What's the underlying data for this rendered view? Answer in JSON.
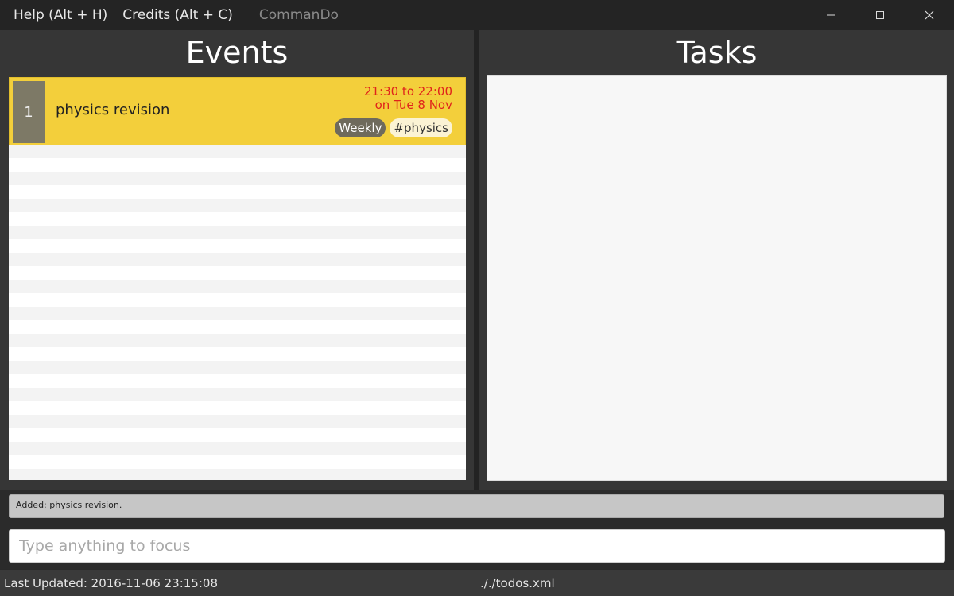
{
  "menu": {
    "help_label": "Help (Alt + H)",
    "credits_label": "Credits (Alt + C)",
    "app_title": "CommanDo"
  },
  "window_controls": {
    "minimize_icon": "minimize-icon",
    "maximize_icon": "maximize-icon",
    "close_icon": "close-icon"
  },
  "events": {
    "title": "Events",
    "items": [
      {
        "index": "1",
        "name": "physics revision",
        "time_line1": "21:30 to 22:00",
        "time_line2": "on Tue 8 Nov",
        "recurrence": "Weekly",
        "tag": "#physics"
      }
    ]
  },
  "tasks": {
    "title": "Tasks",
    "items": []
  },
  "result": {
    "message": "Added: physics revision."
  },
  "command": {
    "placeholder": "Type anything to focus",
    "value": ""
  },
  "status": {
    "last_updated": "Last Updated: 2016-11-06 23:15:08",
    "file_path": "././todos.xml"
  },
  "colors": {
    "event_card": "#f3cf3b",
    "event_index_bg": "#7d7966",
    "event_time": "#e0241b",
    "app_bg": "#2b2b2b"
  }
}
